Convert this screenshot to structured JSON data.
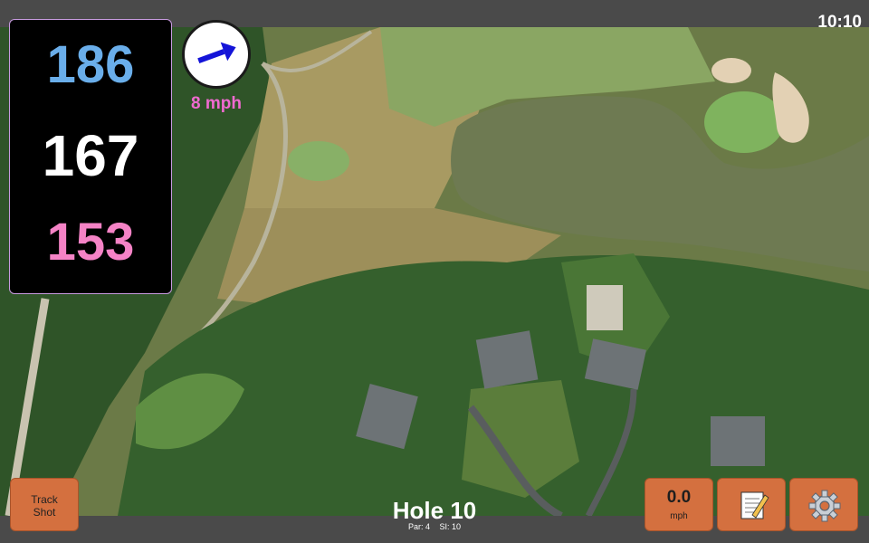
{
  "status": {
    "time": "10:10"
  },
  "yardage": {
    "back": "186",
    "center": "167",
    "front": "153"
  },
  "wind": {
    "speed": "8 mph",
    "direction_icon": "wind-arrow-icon"
  },
  "hole": {
    "title": "Hole 10",
    "par": "Par: 4",
    "stroke_index": "SI: 10"
  },
  "buttons": {
    "track_shot_line1": "Track",
    "track_shot_line2": "Shot",
    "speed_value": "0.0",
    "speed_unit": "mph",
    "notes_icon": "notepad-icon",
    "settings_icon": "gear-icon"
  },
  "colors": {
    "back_yardage": "#6aaeea",
    "center_yardage": "#ffffff",
    "front_yardage": "#f583c6",
    "wind_text": "#f06ad0",
    "button_orange": "#d4703f",
    "wind_arrow": "#1414d8"
  }
}
